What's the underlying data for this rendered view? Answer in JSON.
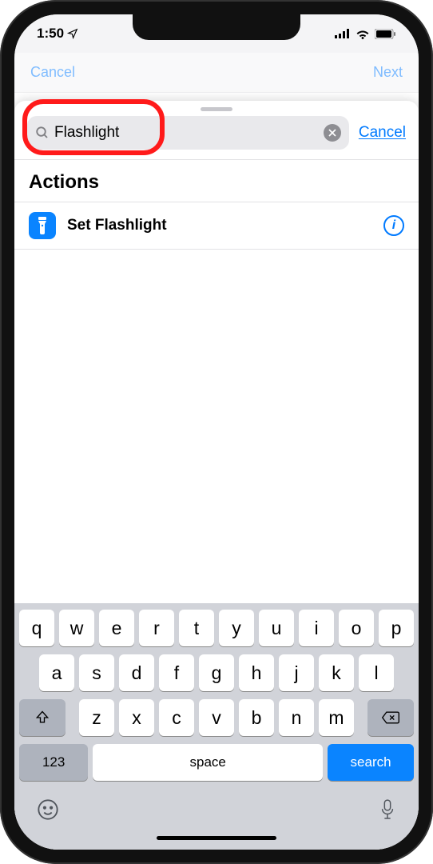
{
  "statusbar": {
    "time": "1:50"
  },
  "behind_nav": {
    "left": "Cancel",
    "right": "Next"
  },
  "search": {
    "value": "Flashlight",
    "cancel": "Cancel"
  },
  "section": {
    "title": "Actions"
  },
  "action": {
    "label": "Set Flashlight"
  },
  "keyboard": {
    "row1": [
      "q",
      "w",
      "e",
      "r",
      "t",
      "y",
      "u",
      "i",
      "o",
      "p"
    ],
    "row2": [
      "a",
      "s",
      "d",
      "f",
      "g",
      "h",
      "j",
      "k",
      "l"
    ],
    "row3": [
      "z",
      "x",
      "c",
      "v",
      "b",
      "n",
      "m"
    ],
    "numbers": "123",
    "space": "space",
    "search": "search"
  }
}
